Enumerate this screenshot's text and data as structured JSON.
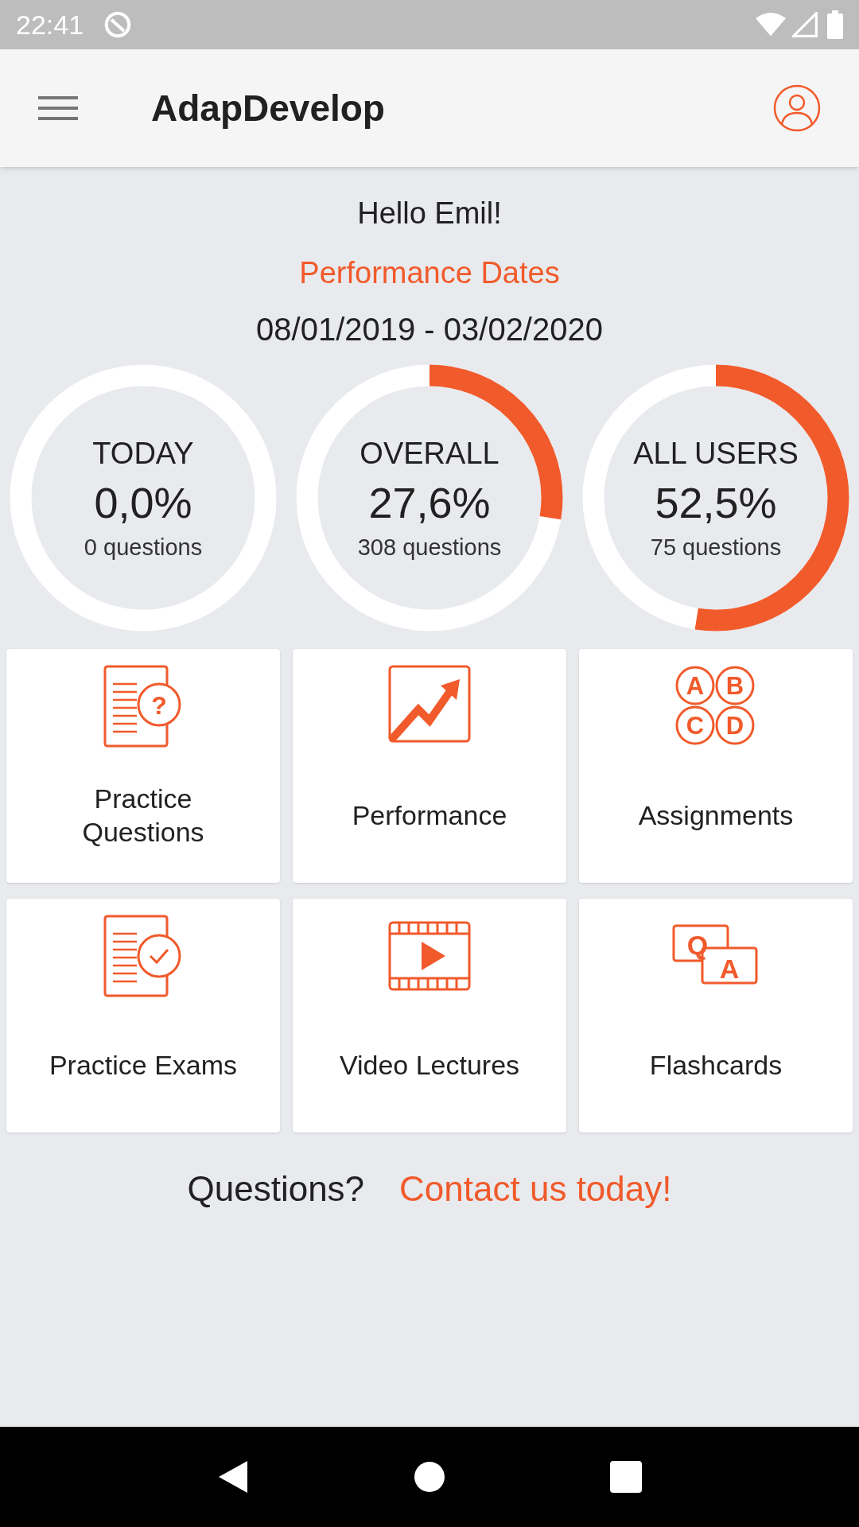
{
  "status_bar": {
    "time": "22:41"
  },
  "app_bar": {
    "title": "AdapDevelop"
  },
  "greeting": "Hello Emil!",
  "performance_dates": {
    "label": "Performance Dates",
    "range": "08/01/2019 - 03/02/2020"
  },
  "stats": [
    {
      "label": "TODAY",
      "value": "0,0%",
      "questions": "0 questions",
      "level": 0
    },
    {
      "label": "OVERALL",
      "value": "27,6%",
      "questions": "308 questions",
      "level": 0.276
    },
    {
      "label": "ALL USERS",
      "value": "52,5%",
      "questions": "75 questions",
      "level": 0.525
    }
  ],
  "tiles": [
    {
      "kind": "questions",
      "label": "Practice Questions",
      "letters": [
        "?"
      ]
    },
    {
      "kind": "chart",
      "label": "Performance"
    },
    {
      "kind": "choices",
      "label": "Assignments",
      "letters": [
        "A",
        "B",
        "C",
        "D"
      ]
    },
    {
      "kind": "exam",
      "label": "Practice Exams"
    },
    {
      "kind": "video",
      "label": "Video Lectures"
    },
    {
      "kind": "cards",
      "label": "Flashcards",
      "letters": [
        "Q",
        "A"
      ]
    }
  ],
  "footer": {
    "question": "Questions?",
    "link": "Contact us today!"
  }
}
